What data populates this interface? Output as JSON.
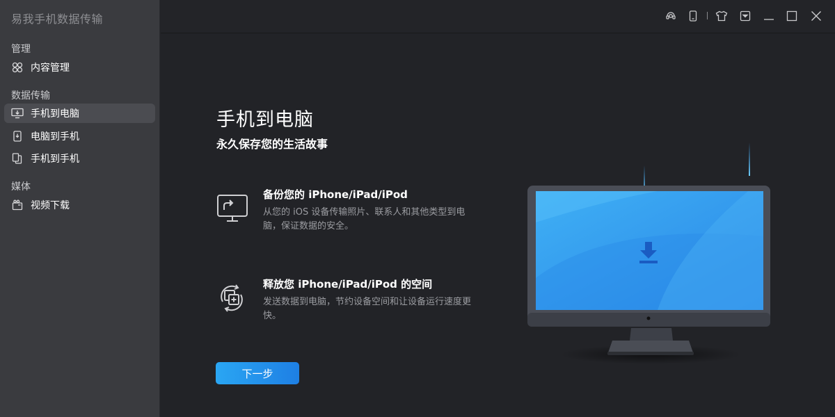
{
  "app": {
    "title": "易我手机数据传输"
  },
  "sidebar": {
    "sections": [
      {
        "label": "管理",
        "items": [
          {
            "label": "内容管理",
            "icon": "grid-icon"
          }
        ]
      },
      {
        "label": "数据传输",
        "items": [
          {
            "label": "手机到电脑",
            "icon": "phone-to-pc-icon",
            "active": true
          },
          {
            "label": "电脑到手机",
            "icon": "pc-to-phone-icon"
          },
          {
            "label": "手机到手机",
            "icon": "phone-to-phone-icon"
          }
        ]
      },
      {
        "label": "媒体",
        "items": [
          {
            "label": "视频下载",
            "icon": "video-download-icon"
          }
        ]
      }
    ]
  },
  "titlebar": {
    "icons": [
      "support-icon",
      "device-icon",
      "skin-icon",
      "menu-dropdown-icon",
      "minimize-icon",
      "maximize-icon",
      "close-icon"
    ]
  },
  "main": {
    "title": "手机到电脑",
    "subtitle": "永久保存您的生活故事",
    "features": [
      {
        "title": "备份您的 iPhone/iPad/iPod",
        "desc": "从您的 iOS 设备传输照片、联系人和其他类型到电脑，保证数据的安全。",
        "icon": "backup-monitor-icon"
      },
      {
        "title": "释放您 iPhone/iPad/iPod 的空间",
        "desc": "发送数据到电脑，节约设备空间和让设备运行速度更快。",
        "icon": "free-space-icon"
      }
    ],
    "next_button": "下一步"
  },
  "colors": {
    "accent": "#1e8ff0",
    "sidebar_bg": "#3a3b3f",
    "main_bg": "#222327",
    "screen_blue": "#3aa0ee"
  }
}
